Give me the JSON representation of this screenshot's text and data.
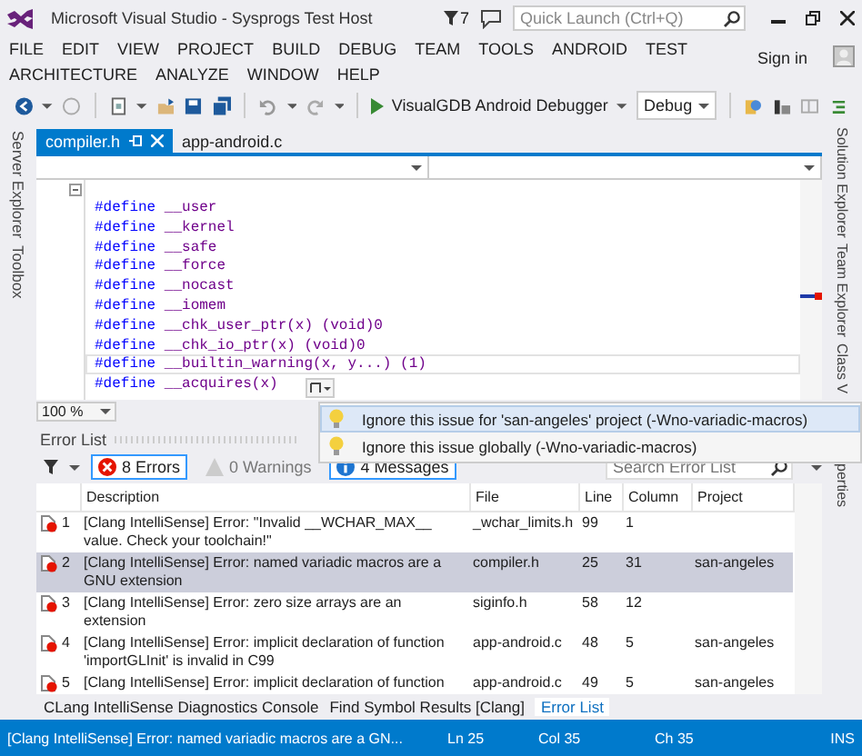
{
  "window": {
    "title": "Microsoft Visual Studio - Sysprogs Test Host",
    "notifications": "7",
    "quick_launch": {
      "placeholder": "Quick Launch (Ctrl+Q)"
    }
  },
  "menu": {
    "items": [
      "FILE",
      "EDIT",
      "VIEW",
      "PROJECT",
      "BUILD",
      "DEBUG",
      "TEAM",
      "TOOLS",
      "ANDROID",
      "TEST",
      "ARCHITECTURE",
      "ANALYZE",
      "WINDOW",
      "HELP"
    ],
    "sign_in": "Sign in"
  },
  "toolbar": {
    "debugger": "VisualGDB Android Debugger",
    "configuration": "Debug"
  },
  "left_dock": [
    "Server Explorer",
    "Toolbox"
  ],
  "right_dock": [
    "Solution Explorer",
    "Team Explorer",
    "Class V",
    "perties"
  ],
  "editor": {
    "tabs": [
      {
        "label": "compiler.h",
        "selected": true
      },
      {
        "label": "app-android.c",
        "selected": false
      }
    ],
    "lines": [
      {
        "text": "#define __user",
        "current": false
      },
      {
        "text": "#define __kernel",
        "current": false
      },
      {
        "text": "#define __safe",
        "current": false
      },
      {
        "text": "#define __force",
        "current": false
      },
      {
        "text": "#define __nocast",
        "current": false
      },
      {
        "text": "#define __iomem",
        "current": false
      },
      {
        "text": "#define __chk_user_ptr(x) (void)0",
        "current": false
      },
      {
        "text": "#define __chk_io_ptr(x) (void)0",
        "current": false
      },
      {
        "text": "#define __builtin_warning(x, y...) (1)",
        "current": true
      },
      {
        "text": "#define __acquires(x)",
        "current": false
      }
    ],
    "zoom": "100 %"
  },
  "quick_actions": [
    {
      "label": "Ignore this issue for 'san-angeles' project (-Wno-variadic-macros)",
      "selected": true
    },
    {
      "label": "Ignore this issue globally (-Wno-variadic-macros)",
      "selected": false
    }
  ],
  "error_list": {
    "title": "Error List",
    "filters": [
      {
        "kind": "errors",
        "label": "8 Errors",
        "selected": true
      },
      {
        "kind": "warnings",
        "label": "0 Warnings",
        "selected": false
      },
      {
        "kind": "messages",
        "label": "4 Messages",
        "selected": true
      }
    ],
    "search": {
      "placeholder": "Search Error List"
    },
    "columns": [
      "Description",
      "File",
      "Line",
      "Column",
      "Project"
    ],
    "rows": [
      {
        "number": "1",
        "description": "[Clang IntelliSense] Error: \"Invalid __WCHAR_MAX__ value. Check your toolchain!\"",
        "file": "_wchar_limits.h",
        "line": "99",
        "column": "1",
        "project": "",
        "selected": false
      },
      {
        "number": "2",
        "description": "[Clang IntelliSense] Error: named variadic macros are a GNU extension",
        "file": "compiler.h",
        "line": "25",
        "column": "31",
        "project": "san-angeles",
        "selected": true
      },
      {
        "number": "3",
        "description": "[Clang IntelliSense] Error: zero size arrays are an extension",
        "file": "siginfo.h",
        "line": "58",
        "column": "12",
        "project": "",
        "selected": false
      },
      {
        "number": "4",
        "description": "[Clang IntelliSense] Error: implicit declaration of function 'importGLInit' is invalid in C99",
        "file": "app-android.c",
        "line": "48",
        "column": "5",
        "project": "san-angeles",
        "selected": false
      },
      {
        "number": "5",
        "description": "[Clang IntelliSense] Error: implicit declaration of function",
        "file": "app-android.c",
        "line": "49",
        "column": "5",
        "project": "san-angeles",
        "selected": false
      }
    ]
  },
  "bottom_tabs": [
    {
      "label": "CLang IntelliSense Diagnostics Console",
      "selected": false
    },
    {
      "label": "Find Symbol Results [Clang]",
      "selected": false
    },
    {
      "label": "Error List",
      "selected": true
    }
  ],
  "status_bar": {
    "message": "[Clang IntelliSense] Error: named variadic macros are a GN...",
    "line": "Ln 25",
    "column": "Col 35",
    "char": "Ch 35",
    "mode": "INS"
  }
}
